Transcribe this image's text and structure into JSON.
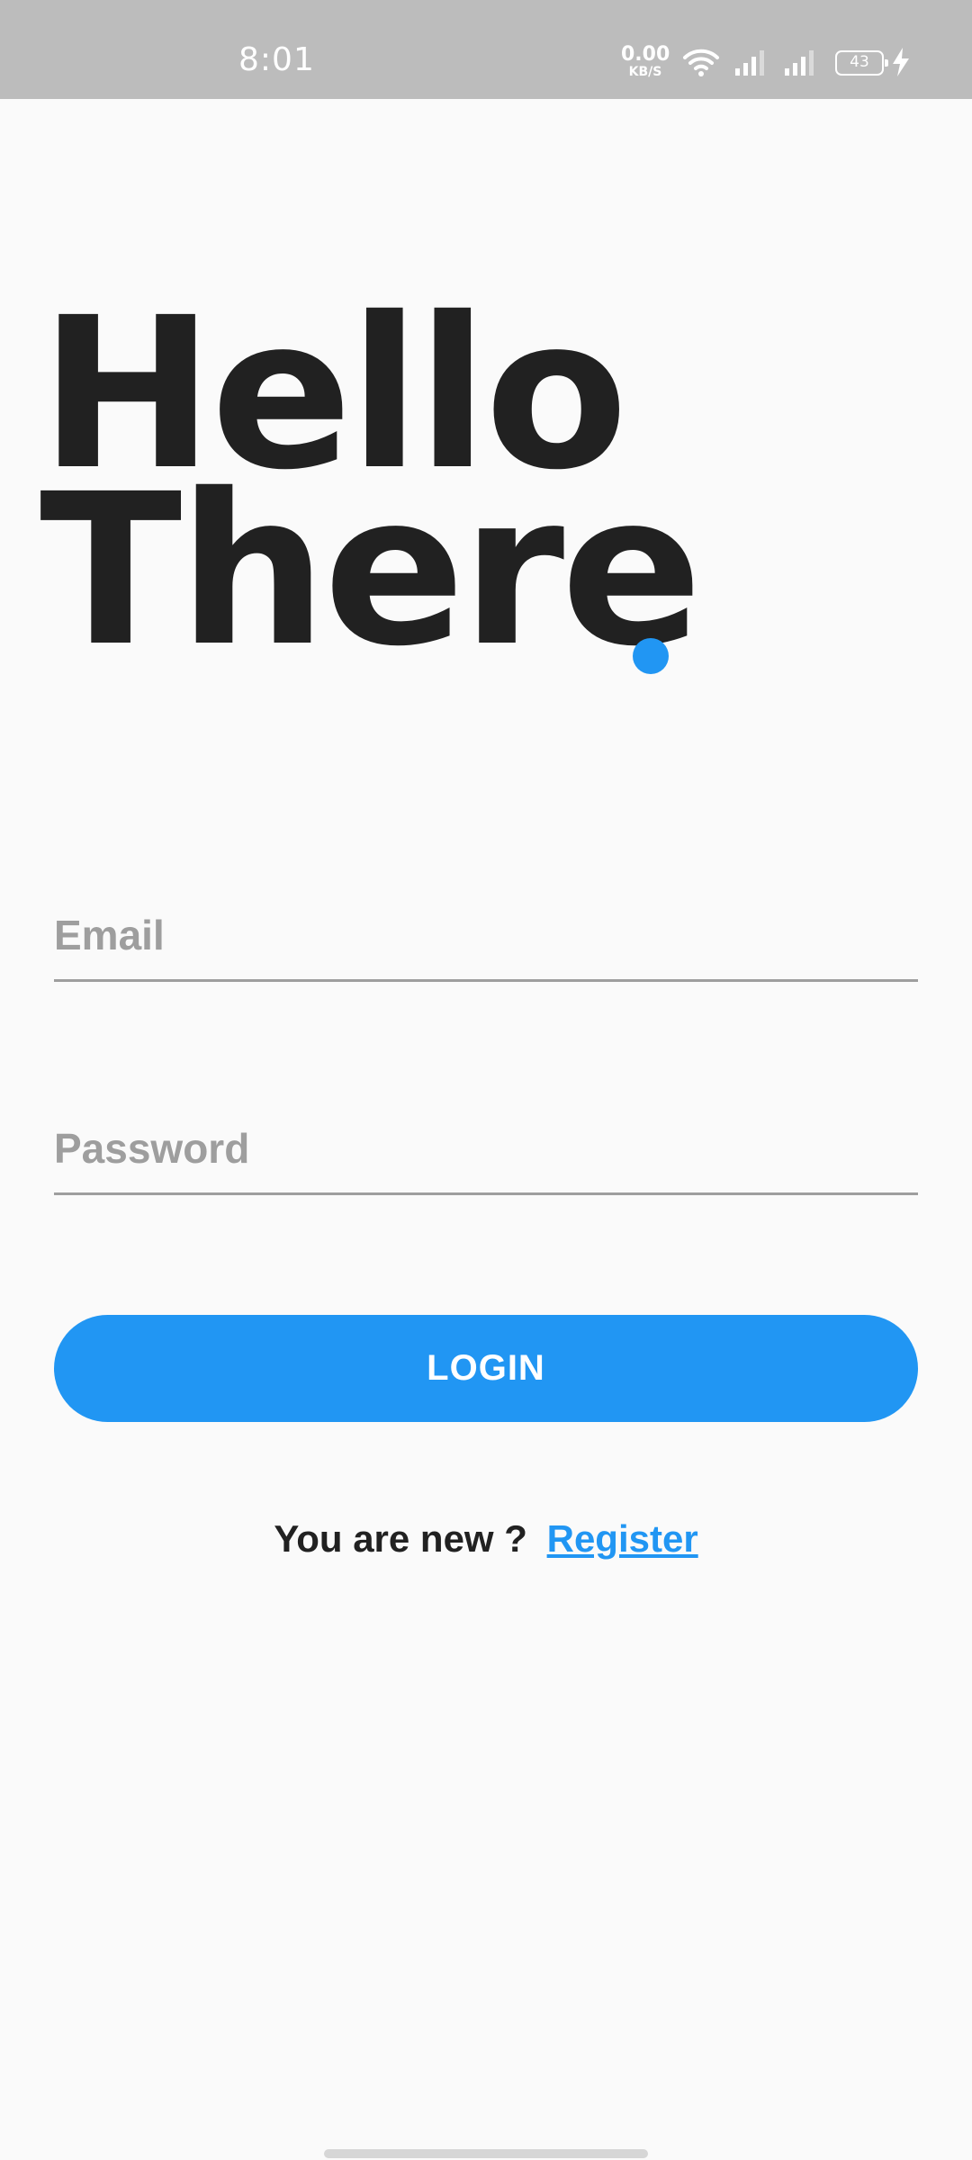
{
  "status_bar": {
    "time": "8:01",
    "net_speed_value": "0.00",
    "net_speed_unit": "KB/S",
    "battery_level": "43",
    "icons": [
      "wifi-icon",
      "signal-icon",
      "signal-icon",
      "battery-icon",
      "charging-icon"
    ]
  },
  "heading": {
    "line1": "Hello",
    "line2": "There",
    "accent_color": "#2196f3"
  },
  "form": {
    "email_placeholder": "Email",
    "email_value": "",
    "password_placeholder": "Password",
    "password_value": "",
    "login_label": "LOGIN"
  },
  "register": {
    "prompt": "You are new ?",
    "link_label": "Register"
  },
  "colors": {
    "primary": "#2196f3",
    "text": "#212121",
    "hint": "#9e9e9e",
    "background": "#fafafa",
    "status_bar": "#bcbcbc"
  }
}
